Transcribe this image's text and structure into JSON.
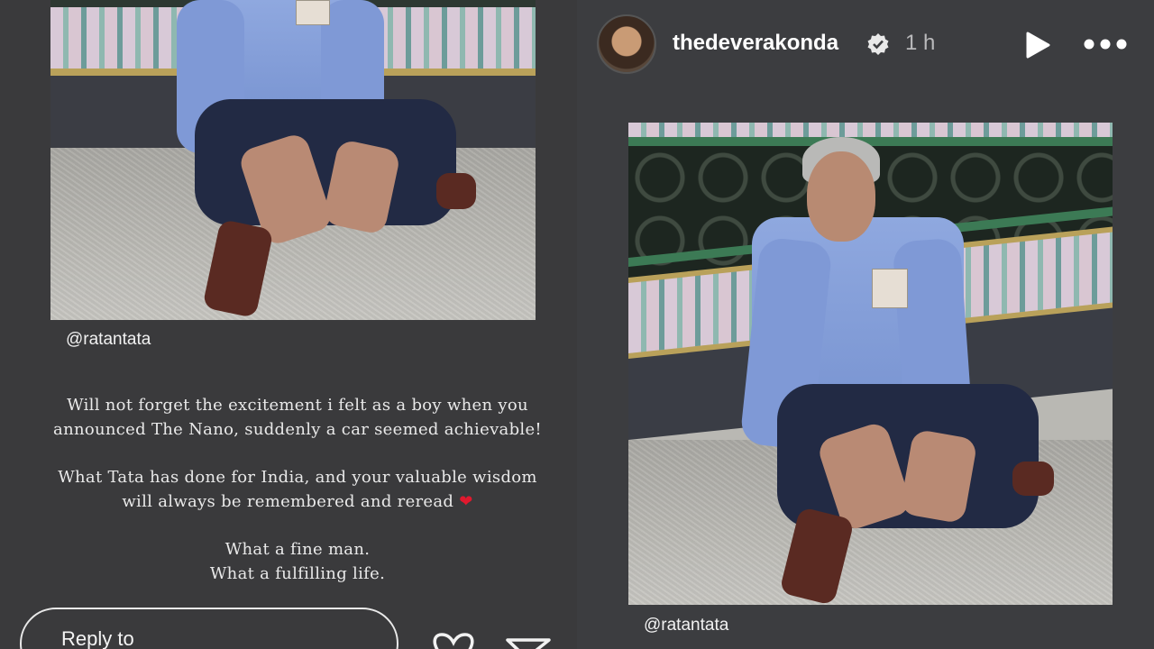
{
  "left_story": {
    "mention": "@ratantata",
    "caption_paragraphs": [
      [
        "Will not forget the excitement i felt as a boy when you",
        "announced The Nano, suddenly a car seemed achievable!"
      ],
      [
        "What Tata has done for India, and your valuable wisdom",
        "will always be remembered and reread ❤️"
      ],
      [
        "What a fine man.",
        "What a fulfilling life."
      ]
    ],
    "reply_placeholder": "Reply to",
    "like_icon": "heart-icon",
    "share_icon": "send-icon"
  },
  "right_story": {
    "username": "thedeverakonda",
    "time_ago": "1 h",
    "verified_icon": "verified-badge-icon",
    "play_icon": "play-icon",
    "more_icon": "more-options-icon",
    "mention": "@ratantata"
  },
  "colors": {
    "background": "#3a3a3c",
    "text": "#ffffff",
    "heart": "#e0192e"
  }
}
